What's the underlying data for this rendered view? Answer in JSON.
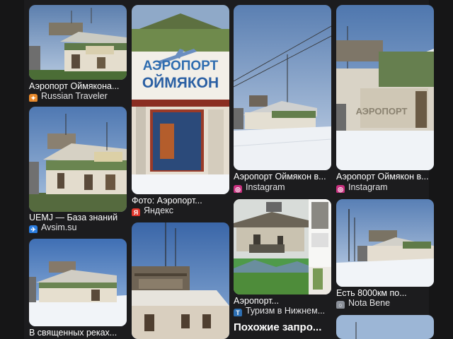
{
  "results": [
    {
      "title": "Аэропорт Оймякона...",
      "source": "Russian Traveler",
      "source_icon": "russian-traveler-icon",
      "icon_color": "#e8892b",
      "icon_glyph": "✦"
    },
    {
      "title": "Фото: Аэропорт...",
      "source": "Яндекс",
      "source_icon": "yandex-icon",
      "icon_color": "#e0352b",
      "icon_glyph": "Я"
    },
    {
      "title": "Аэропорт Оймякон в...",
      "source": "Instagram",
      "source_icon": "instagram-icon",
      "icon_color": "#c9307f",
      "icon_glyph": "◎"
    },
    {
      "title": "Аэропорт Оймякон в...",
      "source": "Instagram",
      "source_icon": "instagram-icon",
      "icon_color": "#c9307f",
      "icon_glyph": "◎"
    },
    {
      "title": "UEMJ — База знаний",
      "source": "Avsim.su",
      "source_icon": "plane-icon",
      "icon_color": "#2a7de1",
      "icon_glyph": "✈"
    },
    {
      "title": "Аэропорт...",
      "source": "Туризм в Нижнем...",
      "source_icon": "tourism-icon",
      "icon_color": "#2d6fb3",
      "icon_glyph": "T"
    },
    {
      "title": "Есть 8000км по...",
      "source": "Nota Bene",
      "source_icon": "nota-bene-icon",
      "icon_color": "#8a8f98",
      "icon_glyph": "○"
    },
    {
      "title": "В священных реках..."
    }
  ],
  "sign": {
    "line1": "АЭРОПОРТ",
    "line2": "ОЙМЯКОН"
  },
  "building_sign": "АЭРОПОРТ",
  "related_heading": "Похожие запро..."
}
